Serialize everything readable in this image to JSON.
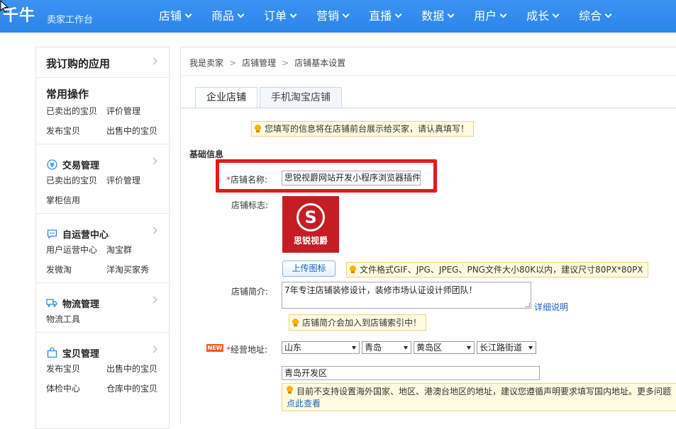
{
  "app": {
    "logo": "千牛",
    "subtitle": "卖家工作台"
  },
  "nav": [
    "店铺",
    "商品",
    "订单",
    "营销",
    "直播",
    "数据",
    "用户",
    "成长",
    "综合"
  ],
  "sidebar": {
    "my_apps": "我订购的应用",
    "common_ops": {
      "title": "常用操作",
      "links": [
        "已卖出的宝贝",
        "评价管理",
        "发布宝贝",
        "出售中的宝贝"
      ]
    },
    "trade": {
      "title": "交易管理",
      "links": [
        "已卖出的宝贝",
        "评价管理",
        "掌柜信用"
      ]
    },
    "self_op": {
      "title": "自运营中心",
      "links": [
        "用户运营中心",
        "淘宝群",
        "发微淘",
        "洋淘买家秀"
      ]
    },
    "logistics": {
      "title": "物流管理",
      "links": [
        "物流工具"
      ]
    },
    "goods": {
      "title": "宝贝管理",
      "links": [
        "发布宝贝",
        "出售中的宝贝",
        "体检中心",
        "仓库中的宝贝"
      ]
    }
  },
  "breadcrumb": [
    "我是卖家",
    "店铺管理",
    "店铺基本设置"
  ],
  "tabs": [
    "企业店铺",
    "手机淘宝店铺"
  ],
  "notice": "您填写的信息将在店铺前台展示给买家，请认真填写！",
  "form": {
    "section_title": "基础信息",
    "shop_name_label": "店铺名称:",
    "shop_name_value": "思锐视爵网站开发小程序浏览器插件",
    "logo_label": "店铺标志:",
    "logo_brand": "思锐视爵",
    "upload_label": "上传图标",
    "upload_tip": "文件格式GIF、JPG、JPEG、PNG文件大小80K以内，建议尺寸80PX*80PX",
    "intro_label": "店铺简介:",
    "intro_value": "7年专注店铺装修设计，装修市场认证设计师团队！",
    "intro_help": "详细说明",
    "intro_tip": "店铺简介会加入到店铺索引中！",
    "address_label": "经营地址:",
    "new_badge": "NEW",
    "province": "山东",
    "city": "青岛",
    "district": "黄岛区",
    "street": "长江路街道",
    "address_detail": "青岛开发区",
    "address_warning": "目前不支持设置海外国家、地区、港澳台地区的地址，建议您遵循声明要求填写国内地址。更多问题",
    "address_warning_link": "点此查看"
  },
  "colors": {
    "topbar": "#2d8cf0",
    "highlight": "#e8171b",
    "link": "#1a62c1"
  }
}
